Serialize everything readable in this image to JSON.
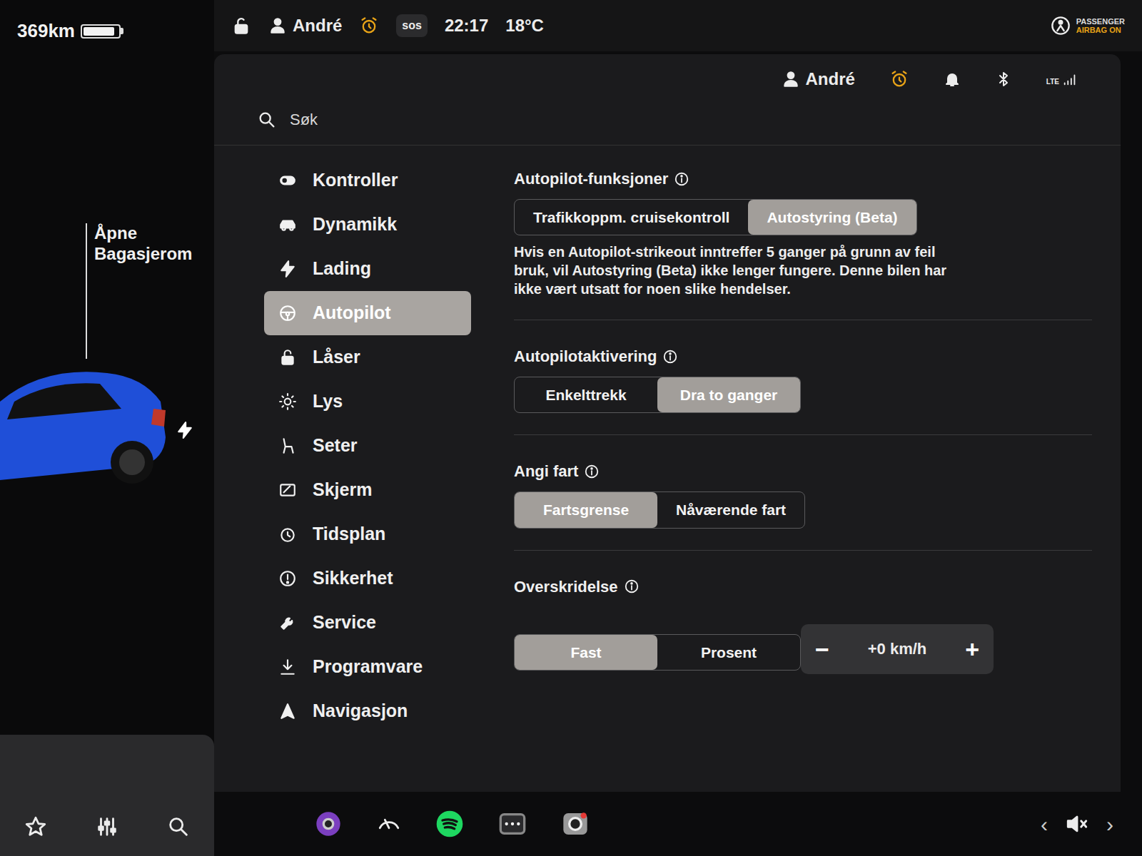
{
  "status_bar": {
    "range": "369km",
    "battery_level": 0.9,
    "user": "André",
    "sos": "sos",
    "time": "22:17",
    "temperature": "18°C",
    "airbag": {
      "line1": "PASSENGER",
      "line2": "AIRBAG ON"
    }
  },
  "car_panel": {
    "trunk_label": "Åpne Bagasjerom",
    "charging": true
  },
  "settings": {
    "user": "André",
    "network": "LTE",
    "search": {
      "placeholder": "Søk"
    },
    "sidebar": {
      "items": [
        {
          "label": "Kontroller",
          "selected": false
        },
        {
          "label": "Dynamikk",
          "selected": false
        },
        {
          "label": "Lading",
          "selected": false
        },
        {
          "label": "Autopilot",
          "selected": true
        },
        {
          "label": "Låser",
          "selected": false
        },
        {
          "label": "Lys",
          "selected": false
        },
        {
          "label": "Seter",
          "selected": false
        },
        {
          "label": "Skjerm",
          "selected": false
        },
        {
          "label": "Tidsplan",
          "selected": false
        },
        {
          "label": "Sikkerhet",
          "selected": false
        },
        {
          "label": "Service",
          "selected": false
        },
        {
          "label": "Programvare",
          "selected": false
        },
        {
          "label": "Navigasjon",
          "selected": false
        }
      ]
    },
    "sections": [
      {
        "title": "Autopilot-funksjoner",
        "options": [
          {
            "label": "Trafikkoppm. cruisekontroll",
            "selected": false
          },
          {
            "label": "Autostyring (Beta)",
            "selected": true
          }
        ],
        "note": "Hvis en Autopilot-strikeout inntreffer 5 ganger på grunn av feil bruk, vil Autostyring (Beta) ikke lenger fungere. Denne bilen har ikke vært utsatt for noen slike hendelser."
      },
      {
        "title": "Autopilotaktivering",
        "options": [
          {
            "label": "Enkelttrekk",
            "selected": false
          },
          {
            "label": "Dra to ganger",
            "selected": true
          }
        ],
        "note": ""
      },
      {
        "title": "Angi fart",
        "options": [
          {
            "label": "Fartsgrense",
            "selected": true
          },
          {
            "label": "Nåværende fart",
            "selected": false
          }
        ],
        "note": ""
      },
      {
        "title": "Overskridelse",
        "options": [
          {
            "label": "Fast",
            "selected": true
          },
          {
            "label": "Prosent",
            "selected": false
          }
        ],
        "note": ""
      }
    ],
    "stepper": {
      "minus": "−",
      "value": "+0 km/h",
      "plus": "+"
    }
  },
  "dock": {
    "prev": "‹",
    "next": "›",
    "volume_muted": true
  }
}
